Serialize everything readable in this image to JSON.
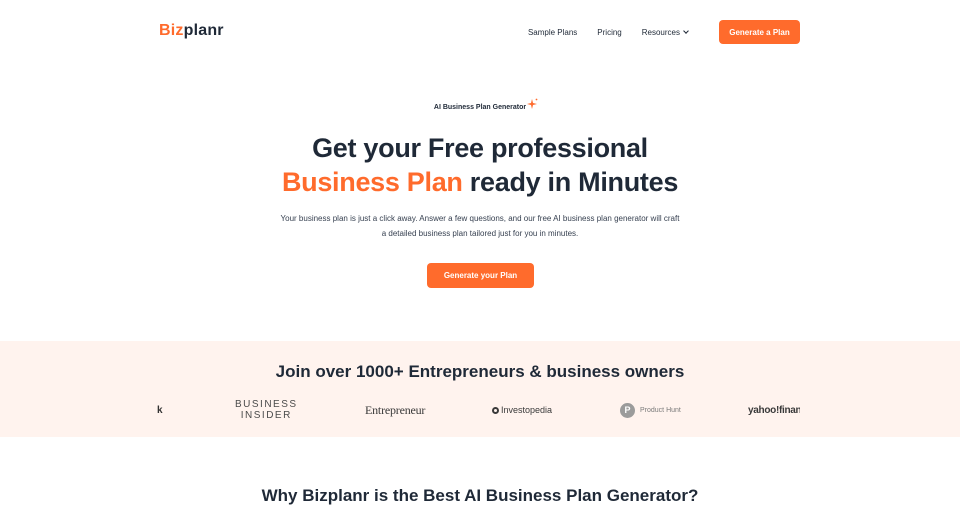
{
  "brand": {
    "logo_accent": "Biz",
    "logo_rest": "planr",
    "accent_color": "#ff6b2c"
  },
  "nav": {
    "items": [
      {
        "label": "Sample Plans"
      },
      {
        "label": "Pricing"
      },
      {
        "label": "Resources"
      }
    ],
    "cta_label": "Generate a Plan"
  },
  "hero": {
    "badge": "AI Business Plan Generator",
    "headline_line1": "Get your Free professional",
    "headline_accent": "Business Plan",
    "headline_line2_rest": " ready in Minutes",
    "subtext": "Your business plan is just a click away. Answer a few questions, and our free AI business plan generator will craft a detailed business plan tailored just for you in minutes.",
    "cta_label": "Generate your Plan"
  },
  "social_proof": {
    "title": "Join over 1000+ Entrepreneurs & business owners",
    "logos": {
      "partial": "k",
      "business_insider_line1": "BUSINESS",
      "business_insider_line2": "INSIDER",
      "entrepreneur": "Entrepreneur",
      "investopedia": "Investopedia",
      "product_hunt_mark": "P",
      "product_hunt": "Product Hunt",
      "yahoo": "yahoo!finance"
    },
    "band_color": "#fff3ee"
  },
  "why_section": {
    "title": "Why Bizplanr is the Best AI Business Plan Generator?"
  }
}
